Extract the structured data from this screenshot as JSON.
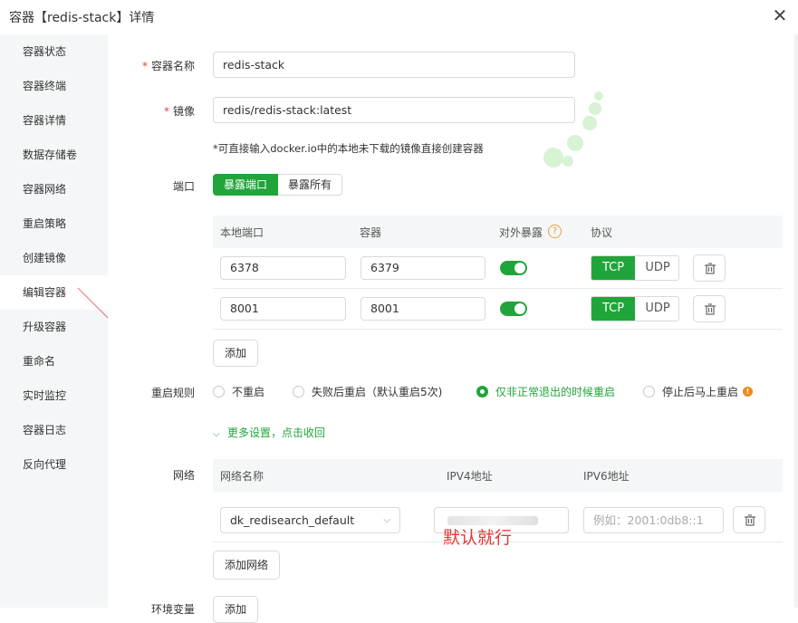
{
  "dialog": {
    "title": "容器【redis-stack】详情"
  },
  "sidebar": {
    "items": [
      {
        "label": "容器状态"
      },
      {
        "label": "容器终端"
      },
      {
        "label": "容器详情"
      },
      {
        "label": "数据存储卷"
      },
      {
        "label": "容器网络"
      },
      {
        "label": "重启策略"
      },
      {
        "label": "创建镜像"
      },
      {
        "label": "编辑容器"
      },
      {
        "label": "升级容器"
      },
      {
        "label": "重命名"
      },
      {
        "label": "实时监控"
      },
      {
        "label": "容器日志"
      },
      {
        "label": "反向代理"
      }
    ],
    "active": "编辑容器"
  },
  "form": {
    "name": {
      "label": "容器名称",
      "value": "redis-stack"
    },
    "image": {
      "label": "镜像",
      "value": "redis/redis-stack:latest",
      "hint": "*可直接输入docker.io中的本地未下载的镜像直接创建容器"
    },
    "ports": {
      "label": "端口",
      "modes": [
        "暴露端口",
        "暴露所有"
      ],
      "headers": {
        "local": "本地端口",
        "container": "容器",
        "expose": "对外暴露",
        "protocol": "协议"
      },
      "rows": [
        {
          "local": "6378",
          "container": "6379",
          "expose": true,
          "protocols": [
            "TCP",
            "UDP"
          ],
          "selected": "TCP"
        },
        {
          "local": "8001",
          "container": "8001",
          "expose": true,
          "protocols": [
            "TCP",
            "UDP"
          ],
          "selected": "TCP"
        }
      ],
      "add_label": "添加"
    },
    "restart": {
      "label": "重启规则",
      "options": [
        "不重启",
        "失败后重启（默认重启5次)",
        "仅非正常退出的时候重启",
        "停止后马上重启"
      ],
      "selected": "仅非正常退出的时候重启"
    },
    "more": {
      "label": "更多设置，点击收回"
    },
    "network": {
      "label": "网络",
      "headers": {
        "name": "网络名称",
        "ipv4": "IPV4地址",
        "ipv6": "IPV6地址"
      },
      "row": {
        "name": "dk_redisearch_default",
        "ipv6_placeholder": "例如：2001:0db8::1"
      },
      "add_label": "添加网络",
      "annotation": "默认就行"
    },
    "env": {
      "label": "环境变量",
      "add_label": "添加"
    }
  },
  "colors": {
    "accent": "#20a53a",
    "annotation": "#e53935"
  }
}
